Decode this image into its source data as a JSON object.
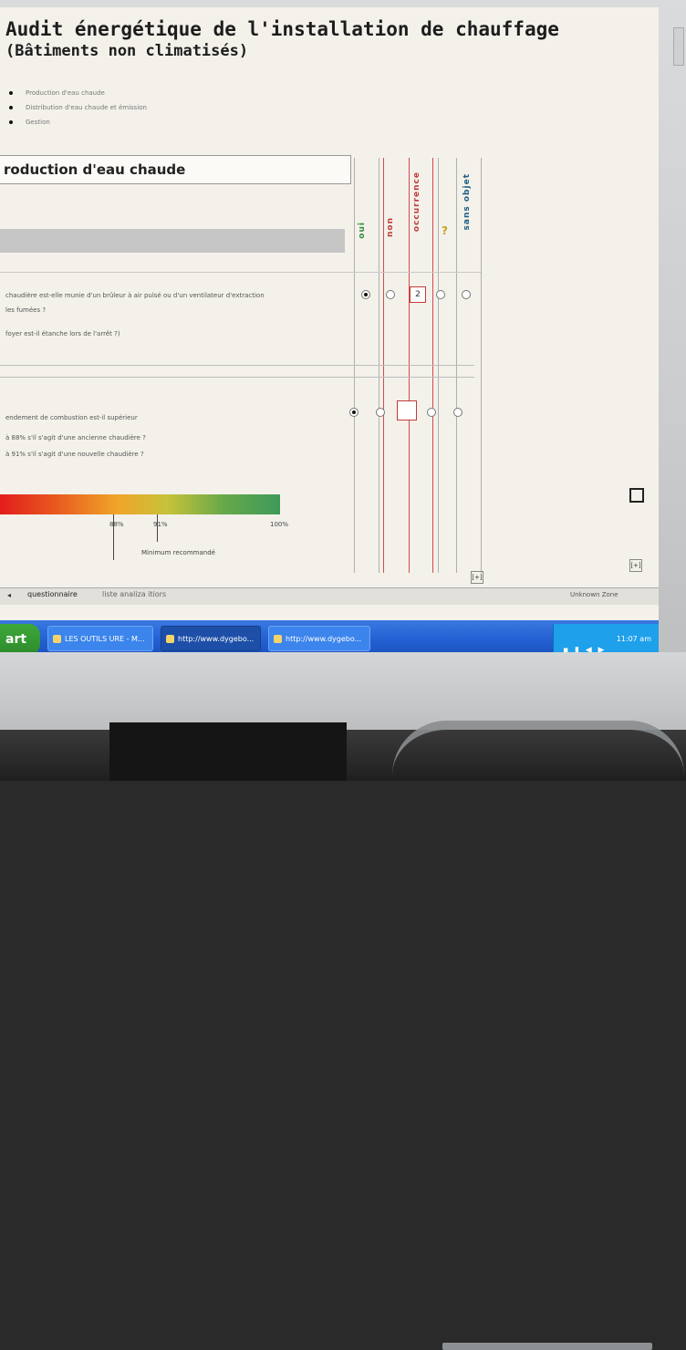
{
  "document": {
    "title": "Audit énergétique de l'installation de chauffage",
    "subtitle": "(Bâtiments non climatisés)",
    "bullets": [
      "Production d'eau chaude",
      "Distribution d'eau chaude et émission",
      "Gestion"
    ]
  },
  "section": {
    "title": "roduction d'eau chaude"
  },
  "columns": {
    "oui": "oui",
    "non": "non",
    "occurrence": "occurrence",
    "question": "?",
    "sans_objet": "sans objet"
  },
  "questions": [
    {
      "lines": [
        "chaudière est-elle munie d'un brûleur à air pulsé ou d'un ventilateur d'extraction",
        "les fumées ?",
        "foyer est-il étanche lors de l'arrêt ?)"
      ],
      "occurrence_value": "2",
      "selected": "oui"
    },
    {
      "lines": [
        "endement de combustion est-il supérieur",
        "à 88% s'il s'agit d'une ancienne chaudière ?",
        "à 91% s'il s'agit d'une nouvelle chaudière ?"
      ],
      "occurrence_value": "",
      "selected": "oui"
    }
  ],
  "gauge": {
    "ticks": [
      "88%",
      "91%",
      "100%"
    ],
    "note": "Minimum recommandé",
    "level": 1.0
  },
  "tabs": {
    "arrow": "◂",
    "questionnaire": "questionnaire",
    "indicateurs": "liste analiza itiors"
  },
  "status": {
    "zone": "Unknown Zone"
  },
  "pager_label": "[+]",
  "taskbar": {
    "start": "art",
    "items": [
      "LES OUTILS URE - M...",
      "http://www.dygebo...",
      "http://www.dygebo..."
    ],
    "tray_time": "11:07 am"
  },
  "colors": {
    "screen_bg": "#f3f1ea",
    "oui_green": "#2f8d3a",
    "non_red": "#c23a3a",
    "question_yellow": "#c9a21c",
    "sans_objet_blue": "#1e5e85",
    "taskbar_blue": "#2360d3",
    "start_green": "#3ea83a"
  }
}
